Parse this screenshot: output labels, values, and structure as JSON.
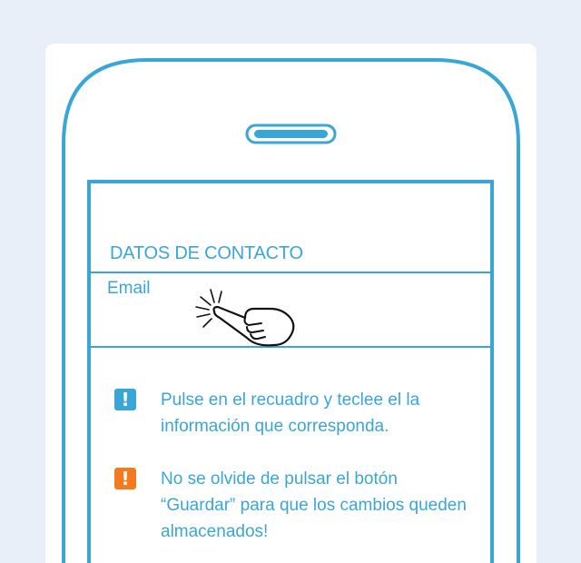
{
  "form": {
    "section_title": "DATOS DE CONTACTO",
    "email_label": "Email"
  },
  "tips": [
    {
      "icon": "exclamation-icon",
      "color": "#3aa6d6",
      "symbol": "!",
      "text": "Pulse en el recuadro y teclee el la información que corresponda."
    },
    {
      "icon": "exclamation-icon",
      "color": "#f47a20",
      "symbol": "!",
      "text": "No se olvide de pulsar el botón “Guardar” para que los cambios queden almacenados!"
    }
  ],
  "colors": {
    "accent": "#3aa6d6",
    "warning": "#f47a20",
    "background": "#e9eff8"
  }
}
